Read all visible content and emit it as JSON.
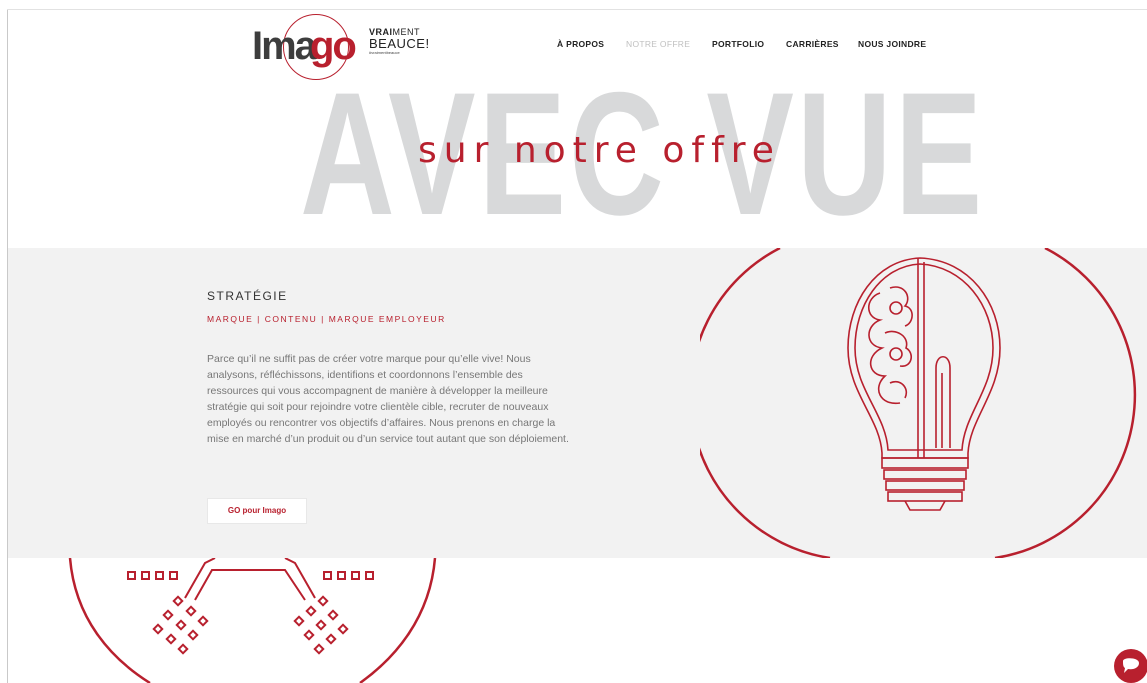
{
  "header": {
    "logo": {
      "part1": "Ima",
      "part2": "go"
    },
    "tagline": {
      "line1_bold": "VRAI",
      "line1_rest": "MENT",
      "line2": "BEAUCE!",
      "line3": "#vraimentbeauce"
    },
    "nav": [
      {
        "label": "À PROPOS",
        "active": false
      },
      {
        "label": "NOTRE OFFRE",
        "active": true
      },
      {
        "label": "PORTFOLIO",
        "active": false
      },
      {
        "label": "CARRIÈRES",
        "active": false
      },
      {
        "label": "NOUS JOINDRE",
        "active": false
      }
    ]
  },
  "hero": {
    "background_text": "AVEC VUE",
    "subtitle": "sur notre offre"
  },
  "strategy": {
    "title": "STRATÉGIE",
    "tags": "MARQUE | CONTENU | MARQUE EMPLOYEUR",
    "body": "Parce qu’il ne suffit pas de créer votre marque pour qu’elle vive! Nous analysons, réfléchissons, identifions et coordonnons l’ensemble des ressources qui vous accompagnent de manière à développer la meilleure stratégie qui soit pour rejoindre votre clientèle cible, recruter de nouveaux employés ou rencontrer vos objectifs d’affaires. Nous prenons en charge la mise en marché d’un produit ou d’un service tout autant que son déploiement.",
    "button_label": "GO pour Imago",
    "illustration": "lightbulb-brain-icon"
  },
  "next_section": {
    "illustration": "megaphone-rays-icon"
  },
  "chat": {
    "icon": "chat-bubble-icon"
  },
  "colors": {
    "accent": "#b8202e",
    "hero_text": "#d8d9da",
    "section_bg": "#f2f2f2"
  }
}
